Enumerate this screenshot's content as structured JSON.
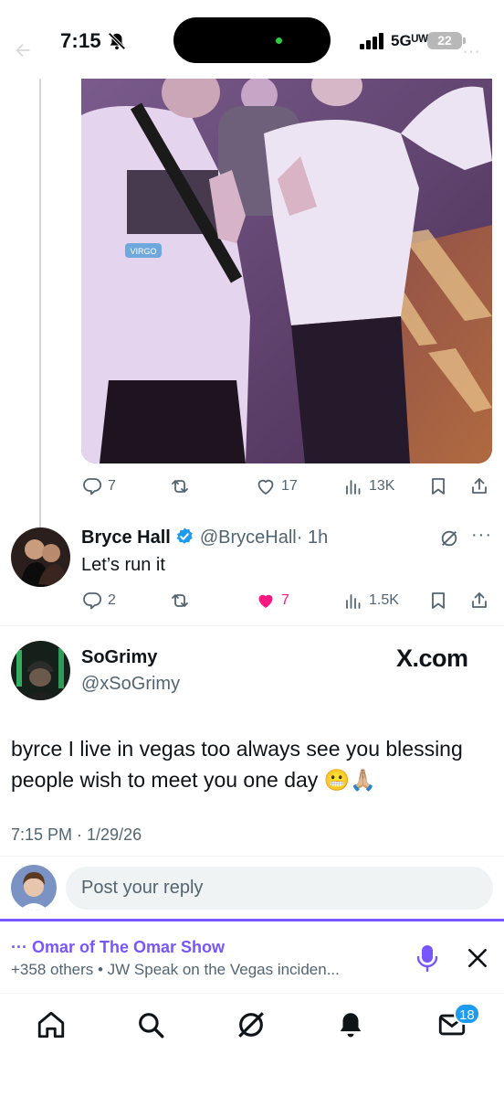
{
  "status_bar": {
    "time": "7:15",
    "network": "5Gᵁᵂ",
    "battery": "22"
  },
  "photo_post": {
    "image_label": "VIRGO",
    "actions": {
      "replies": "7",
      "reposts": "",
      "likes": "17",
      "views": "13K"
    }
  },
  "reply": {
    "name": "Bryce Hall",
    "handle": "@BryceHall",
    "time": "· 1h",
    "text": "Let’s run it",
    "actions": {
      "replies": "2",
      "likes": "7",
      "views": "1.5K"
    },
    "colors": {
      "liked": "#f91880"
    }
  },
  "main_tweet": {
    "name": "SoGrimy",
    "handle": "@xSoGrimy",
    "watermark": "X.com",
    "text": "byrce I live in vegas too always see you blessing people wish to meet you one day 😬🙏🏼",
    "timestamp": "7:15 PM · 1/29/26"
  },
  "composer": {
    "placeholder": "Post your reply"
  },
  "spaces": {
    "host": "··· Omar of The Omar Show",
    "subtitle": "+358 others • JW Speak on the Vegas inciden...",
    "accent": "#7856ff"
  },
  "nav": {
    "items": [
      "home-icon",
      "search-icon",
      "grok-icon",
      "notifications-icon",
      "messages-icon"
    ],
    "messages_badge": "18",
    "accent": "#1d9bf0"
  }
}
